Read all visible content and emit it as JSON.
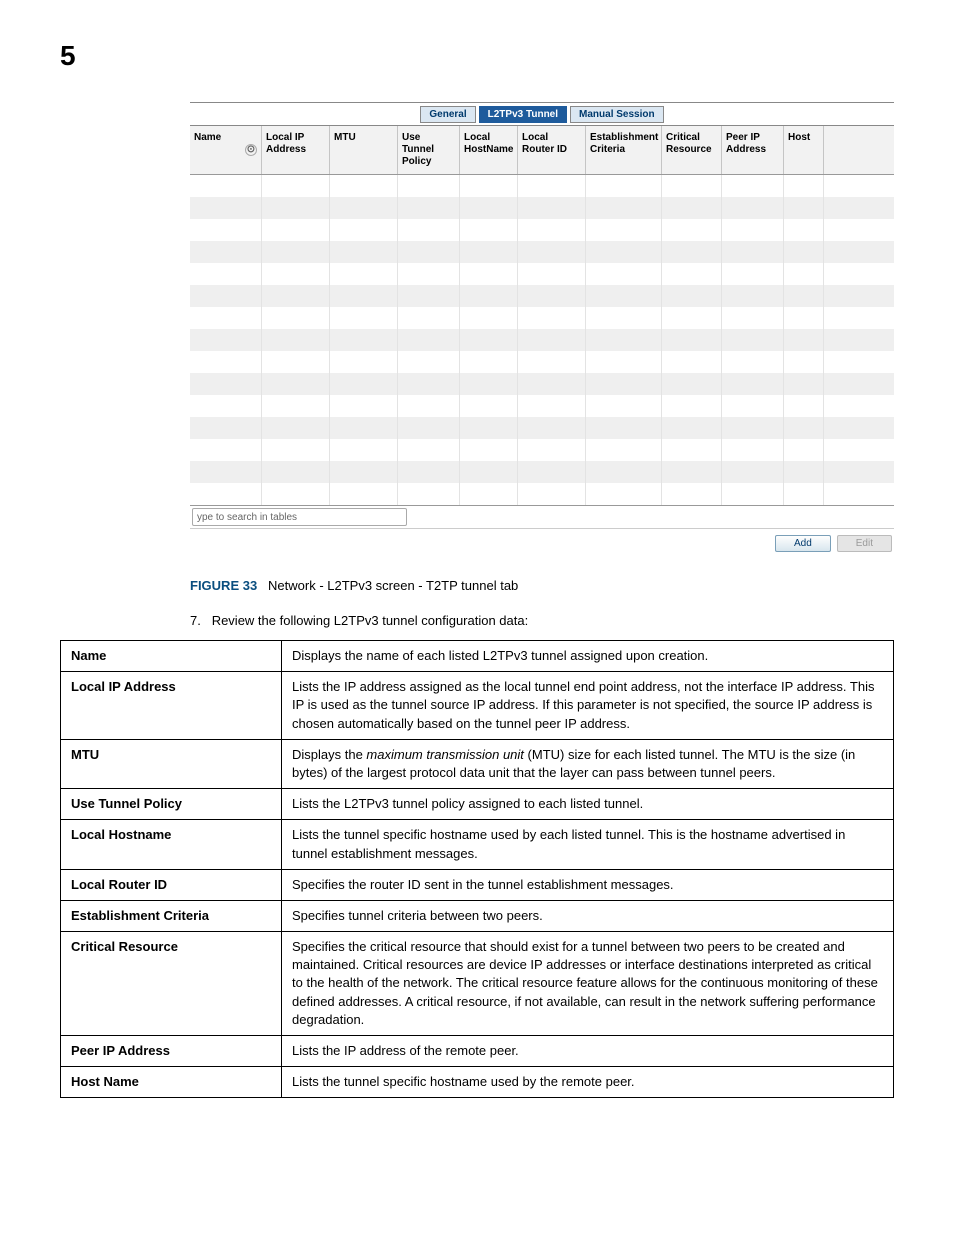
{
  "page_number": "5",
  "screenshot": {
    "tabs": [
      {
        "label": "General",
        "active": false
      },
      {
        "label": "L2TPv3 Tunnel",
        "active": true
      },
      {
        "label": "Manual Session",
        "active": false
      }
    ],
    "columns": [
      {
        "label": "Name",
        "sortable": true
      },
      {
        "label": "Local IP Address"
      },
      {
        "label": "MTU"
      },
      {
        "label": "Use Tunnel Policy"
      },
      {
        "label": "Local HostName"
      },
      {
        "label": "Local Router ID"
      },
      {
        "label": "Establishment Criteria"
      },
      {
        "label": "Critical Resource"
      },
      {
        "label": "Peer IP Address"
      },
      {
        "label": "Host"
      }
    ],
    "row_count": 15,
    "search_placeholder": "ype to search in tables",
    "buttons": {
      "add": "Add",
      "edit": "Edit"
    }
  },
  "figure_label": "FIGURE 33",
  "figure_title": "Network - L2TPv3 screen - T2TP tunnel tab",
  "step_number": "7.",
  "step_text": "Review the following L2TPv3 tunnel configuration data:",
  "spec_rows": [
    {
      "name": "Name",
      "desc": "Displays the name of each listed L2TPv3 tunnel assigned upon creation."
    },
    {
      "name": "Local IP Address",
      "desc": "Lists the IP address assigned as the local tunnel end point address, not the interface IP address. This IP is used as the tunnel source IP address. If this parameter is not specified, the source IP address is chosen automatically based on the tunnel peer IP address."
    },
    {
      "name": "MTU",
      "desc_prefix": "Displays the ",
      "desc_italic": "maximum transmission unit",
      "desc_suffix": " (MTU) size for each listed tunnel. The MTU is the size (in bytes) of the largest protocol data unit that the layer can pass between tunnel peers."
    },
    {
      "name": "Use Tunnel Policy",
      "desc": "Lists the L2TPv3 tunnel policy assigned to each listed tunnel."
    },
    {
      "name": "Local Hostname",
      "desc": "Lists the tunnel specific hostname used by each listed tunnel. This is the hostname advertised in tunnel establishment messages."
    },
    {
      "name": "Local Router ID",
      "desc": "Specifies the router ID sent in the tunnel establishment messages."
    },
    {
      "name": "Establishment Criteria",
      "desc": "Specifies tunnel criteria between two peers."
    },
    {
      "name": "Critical Resource",
      "desc": "Specifies the critical resource that should exist for a tunnel between two peers to be created and maintained. Critical resources are device IP addresses or interface destinations interpreted as critical to the health of the network. The critical resource feature allows for the continuous monitoring of these defined addresses. A critical resource, if not available, can result in the network suffering performance degradation."
    },
    {
      "name": "Peer IP Address",
      "desc": "Lists the IP address of the remote peer."
    },
    {
      "name": "Host Name",
      "desc": "Lists the tunnel specific hostname used by the remote peer."
    }
  ]
}
